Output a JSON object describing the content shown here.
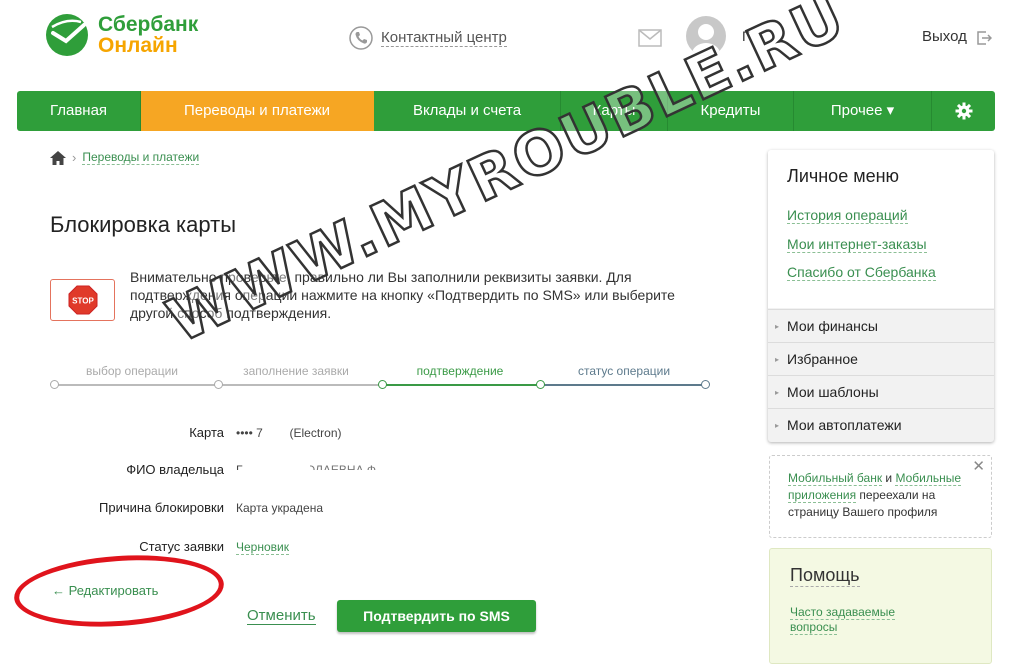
{
  "header": {
    "logo_line1": "Сбербанк",
    "logo_line2": "Онлайн",
    "contact_label": "Контактный центр",
    "user_name_first_letter": "Г",
    "logout_label": "Выход"
  },
  "nav": {
    "items": [
      {
        "label": "Главная",
        "active": false
      },
      {
        "label": "Переводы и платежи",
        "active": true
      },
      {
        "label": "Вклады и счета",
        "active": false
      },
      {
        "label": "Карты",
        "active": false
      },
      {
        "label": "Кредиты",
        "active": false
      },
      {
        "label": "Прочее ▾",
        "active": false
      }
    ],
    "settings_icon": "gear-icon"
  },
  "breadcrumb": {
    "home_icon": "home-icon",
    "separator": "›",
    "link": "Переводы и платежи"
  },
  "page": {
    "title": "Блокировка карты",
    "stop_icon_text": "STOP",
    "warning": "Внимательно проверьте, правильно ли Вы заполнили реквизиты заявки. Для подтверждения операции нажмите на кнопку «Подтвердить по SMS» или выберите другой способ подтверждения."
  },
  "stepper": {
    "steps": [
      {
        "label": "выбор операции",
        "state": "done"
      },
      {
        "label": "заполнение заявки",
        "state": "done"
      },
      {
        "label": "подтверждение",
        "state": "current"
      },
      {
        "label": "статус операции",
        "state": "pending"
      }
    ]
  },
  "form": {
    "card_label": "Карта",
    "card_value": "•••• 7",
    "card_type": "(Electron)",
    "holder_label": "ФИО владельца",
    "holder_value": "Г",
    "holder_value_tail": "ОЛАЕВНА Ф",
    "reason_label": "Причина блокировки",
    "reason_value": "Карта украдена",
    "status_label": "Статус заявки",
    "status_value": "Черновик"
  },
  "actions": {
    "edit_label": "← Редактировать",
    "cancel_label": "Отменить",
    "confirm_label": "Подтвердить по SMS"
  },
  "sidebar": {
    "title": "Личное меню",
    "links": [
      "История операций",
      "Мои интернет-заказы",
      "Спасибо от Сбербанка"
    ],
    "items": [
      "Мои финансы",
      "Избранное",
      "Мои шаблоны",
      "Мои автоплатежи"
    ],
    "item_arrow": "▸"
  },
  "mobile_notice": {
    "link1": "Мобильный банк",
    "and": " и ",
    "link2": "Мобильные приложения",
    "text": " переехали на страницу Вашего профиля",
    "close": "✕"
  },
  "help": {
    "title": "Помощь",
    "link": "Часто задаваемые вопросы"
  },
  "watermark": "WWW.MYROUBLE.RU",
  "colors": {
    "brand_green": "#2f9e3a",
    "active_orange": "#f6a623",
    "link_green": "#3a8f50",
    "highlight_red": "#e0141c"
  }
}
